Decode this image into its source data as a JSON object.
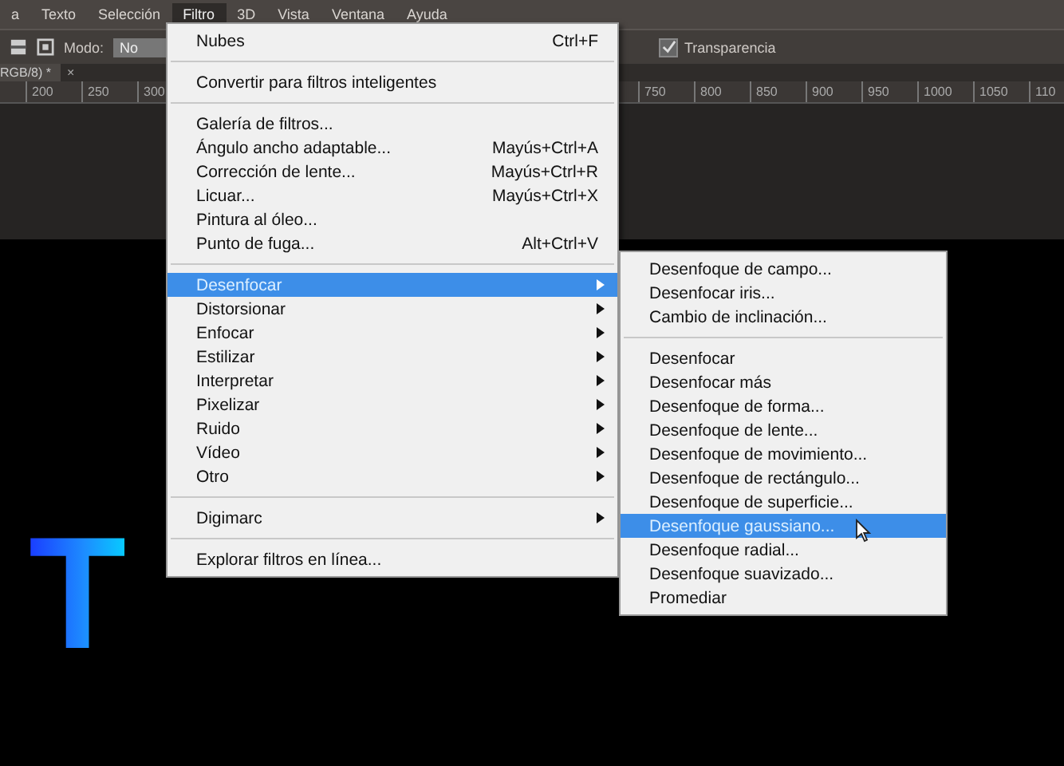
{
  "menubar": [
    {
      "label": "a",
      "selected": false
    },
    {
      "label": "Texto",
      "selected": false
    },
    {
      "label": "Selección",
      "selected": false
    },
    {
      "label": "Filtro",
      "selected": true
    },
    {
      "label": "3D",
      "selected": false
    },
    {
      "label": "Vista",
      "selected": false
    },
    {
      "label": "Ventana",
      "selected": false
    },
    {
      "label": "Ayuda",
      "selected": false
    }
  ],
  "options_bar": {
    "mode_label": "Modo:",
    "mode_value": "No",
    "transparency": {
      "label": "Transparencia",
      "checked": true
    }
  },
  "document_tab": {
    "title": "RGB/8) *",
    "close": "×"
  },
  "ruler": {
    "left_ticks": [
      "200",
      "250",
      "300"
    ],
    "right_ticks": [
      "750",
      "800",
      "850",
      "900",
      "950",
      "1000",
      "1050",
      "110"
    ]
  },
  "canvas_text": "T",
  "filter_menu": {
    "items": [
      {
        "kind": "item",
        "label": "Nubes",
        "shortcut": "Ctrl+F",
        "selected": false,
        "has_submenu": false
      },
      {
        "kind": "separator"
      },
      {
        "kind": "item",
        "label": "Convertir para filtros inteligentes",
        "selected": false,
        "has_submenu": false
      },
      {
        "kind": "separator"
      },
      {
        "kind": "item",
        "label": "Galería de filtros...",
        "selected": false,
        "has_submenu": false
      },
      {
        "kind": "item",
        "label": "Ángulo ancho adaptable...",
        "shortcut": "Mayús+Ctrl+A",
        "selected": false,
        "has_submenu": false
      },
      {
        "kind": "item",
        "label": "Corrección de lente...",
        "shortcut": "Mayús+Ctrl+R",
        "selected": false,
        "has_submenu": false
      },
      {
        "kind": "item",
        "label": "Licuar...",
        "shortcut": "Mayús+Ctrl+X",
        "selected": false,
        "has_submenu": false
      },
      {
        "kind": "item",
        "label": "Pintura al óleo...",
        "selected": false,
        "has_submenu": false
      },
      {
        "kind": "item",
        "label": "Punto de fuga...",
        "shortcut": "Alt+Ctrl+V",
        "selected": false,
        "has_submenu": false
      },
      {
        "kind": "separator"
      },
      {
        "kind": "item",
        "label": "Desenfocar",
        "selected": true,
        "has_submenu": true
      },
      {
        "kind": "item",
        "label": "Distorsionar",
        "selected": false,
        "has_submenu": true
      },
      {
        "kind": "item",
        "label": "Enfocar",
        "selected": false,
        "has_submenu": true
      },
      {
        "kind": "item",
        "label": "Estilizar",
        "selected": false,
        "has_submenu": true
      },
      {
        "kind": "item",
        "label": "Interpretar",
        "selected": false,
        "has_submenu": true
      },
      {
        "kind": "item",
        "label": "Pixelizar",
        "selected": false,
        "has_submenu": true
      },
      {
        "kind": "item",
        "label": "Ruido",
        "selected": false,
        "has_submenu": true
      },
      {
        "kind": "item",
        "label": "Vídeo",
        "selected": false,
        "has_submenu": true
      },
      {
        "kind": "item",
        "label": "Otro",
        "selected": false,
        "has_submenu": true
      },
      {
        "kind": "separator"
      },
      {
        "kind": "item",
        "label": "Digimarc",
        "selected": false,
        "has_submenu": true
      },
      {
        "kind": "separator"
      },
      {
        "kind": "item",
        "label": "Explorar filtros en línea...",
        "selected": false,
        "has_submenu": false
      }
    ]
  },
  "blur_submenu": {
    "items": [
      {
        "kind": "item",
        "label": "Desenfoque de campo...",
        "selected": false
      },
      {
        "kind": "item",
        "label": "Desenfocar iris...",
        "selected": false
      },
      {
        "kind": "item",
        "label": "Cambio de inclinación...",
        "selected": false
      },
      {
        "kind": "separator"
      },
      {
        "kind": "item",
        "label": "Desenfocar",
        "selected": false
      },
      {
        "kind": "item",
        "label": "Desenfocar más",
        "selected": false
      },
      {
        "kind": "item",
        "label": "Desenfoque de forma...",
        "selected": false
      },
      {
        "kind": "item",
        "label": "Desenfoque de lente...",
        "selected": false
      },
      {
        "kind": "item",
        "label": "Desenfoque de movimiento...",
        "selected": false
      },
      {
        "kind": "item",
        "label": "Desenfoque de rectángulo...",
        "selected": false
      },
      {
        "kind": "item",
        "label": "Desenfoque de superficie...",
        "selected": false
      },
      {
        "kind": "item",
        "label": "Desenfoque gaussiano...",
        "selected": true
      },
      {
        "kind": "item",
        "label": "Desenfoque radial...",
        "selected": false
      },
      {
        "kind": "item",
        "label": "Desenfoque suavizado...",
        "selected": false
      },
      {
        "kind": "item",
        "label": "Promediar",
        "selected": false
      }
    ]
  }
}
